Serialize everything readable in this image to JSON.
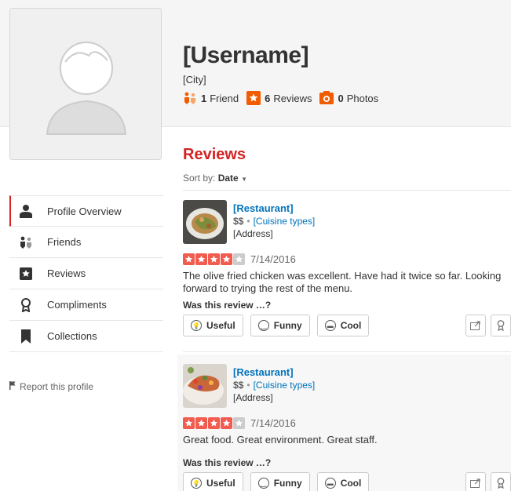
{
  "profile": {
    "username": "[Username]",
    "city": "[City]",
    "friends_count": "1",
    "friends_label": "Friend",
    "reviews_count": "6",
    "reviews_label": "Reviews",
    "photos_count": "0",
    "photos_label": "Photos"
  },
  "sidebar": {
    "items": [
      {
        "label": "Profile Overview",
        "icon": "person-icon"
      },
      {
        "label": "Friends",
        "icon": "friends-icon"
      },
      {
        "label": "Reviews",
        "icon": "star-icon"
      },
      {
        "label": "Compliments",
        "icon": "compliment-icon"
      },
      {
        "label": "Collections",
        "icon": "bookmark-icon"
      }
    ],
    "report": "Report this profile"
  },
  "reviews": {
    "title": "Reviews",
    "sort_prefix": "Sort by:",
    "sort_value": "Date",
    "helpful_prompt": "Was this review …?",
    "vote_useful": "Useful",
    "vote_funny": "Funny",
    "vote_cool": "Cool",
    "items": [
      {
        "business": "[Restaurant]",
        "price": "$$",
        "cuisine": "[Cuisine types]",
        "address": "[Address]",
        "rating": 4,
        "date": "7/14/2016",
        "text": "The olive fried chicken was excellent.  Have had it twice so far.  Looking forward to trying the rest of the menu."
      },
      {
        "business": "[Restaurant]",
        "price": "$$",
        "cuisine": "[Cuisine types]",
        "address": "[Address]",
        "rating": 4,
        "date": "7/14/2016",
        "text": "Great food.  Great environment. Great staff."
      }
    ]
  },
  "colors": {
    "brand_red": "#d32323",
    "link_blue": "#0073bb",
    "star_red": "#f15c4f",
    "friends_orange": "#f15c00",
    "photos_orange": "#f15c00"
  }
}
